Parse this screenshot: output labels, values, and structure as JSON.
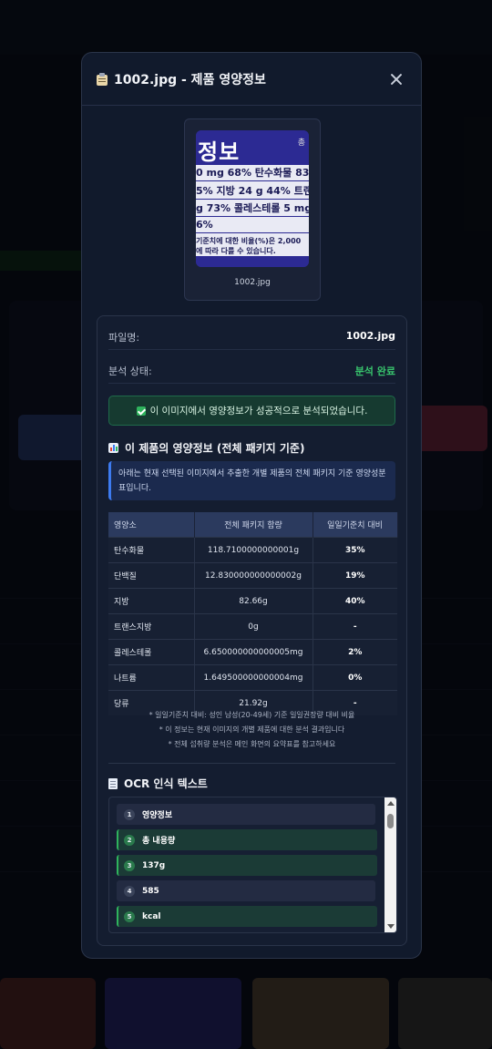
{
  "modal": {
    "title": "1002.jpg - 제품 영양정보",
    "image_caption": "1002.jpg",
    "preview_text": {
      "title": "정보",
      "vertical": "총",
      "rows": [
        "0 mg 68% 탄수화물 83",
        "5% 지방 24 g 44% 트랜",
        "g 73% 콜레스테롤 5 mg",
        "6%",
        "기준치에 대한 비율(%)은 2,000",
        "에 따라 다를 수 있습니다."
      ]
    }
  },
  "info": {
    "file_label": "파일명:",
    "file_value": "1002.jpg",
    "status_label": "분석 상태:",
    "status_value": "분석 완료",
    "success_message": "이 이미지에서 영양정보가 성공적으로 분석되었습니다."
  },
  "nutrition": {
    "title": "이 제품의 영양정보 (전체 패키지 기준)",
    "notice": "아래는 현재 선택된 이미지에서 추출한 개별 제품의 전체 패키지 기준 영양성분표입니다.",
    "headers": [
      "영양소",
      "전체 패키지 함량",
      "일일기준치 대비"
    ],
    "rows": [
      [
        "탄수화물",
        "118.7100000000001g",
        "35%"
      ],
      [
        "단백질",
        "12.830000000000002g",
        "19%"
      ],
      [
        "지방",
        "82.66g",
        "40%"
      ],
      [
        "트랜스지방",
        "0g",
        "-"
      ],
      [
        "콜레스테롤",
        "6.650000000000005mg",
        "2%"
      ],
      [
        "나트륨",
        "1.649500000000004mg",
        "0%"
      ],
      [
        "당류",
        "21.92g",
        "-"
      ]
    ],
    "footnotes": [
      "* 일일기준치 대비: 성인 남성(20-49세) 기준 일일권장량 대비 비율",
      "* 이 정보는 현재 이미지의 개별 제품에 대한 분석 결과입니다",
      "* 전체 섭취량 분석은 메인 화면의 요약표를 참고하세요"
    ]
  },
  "ocr": {
    "title": "OCR 인식 텍스트",
    "items": [
      {
        "num": "1",
        "text": "영양정보",
        "highlight": false
      },
      {
        "num": "2",
        "text": "총 내용량",
        "highlight": true
      },
      {
        "num": "3",
        "text": "137g",
        "highlight": true
      },
      {
        "num": "4",
        "text": "585",
        "highlight": false
      },
      {
        "num": "5",
        "text": "kcal",
        "highlight": true
      }
    ]
  },
  "colors": {
    "accent_green": "#38c46d",
    "header_blue": "#2b3a5e",
    "notice_border": "#3d7bf0"
  }
}
